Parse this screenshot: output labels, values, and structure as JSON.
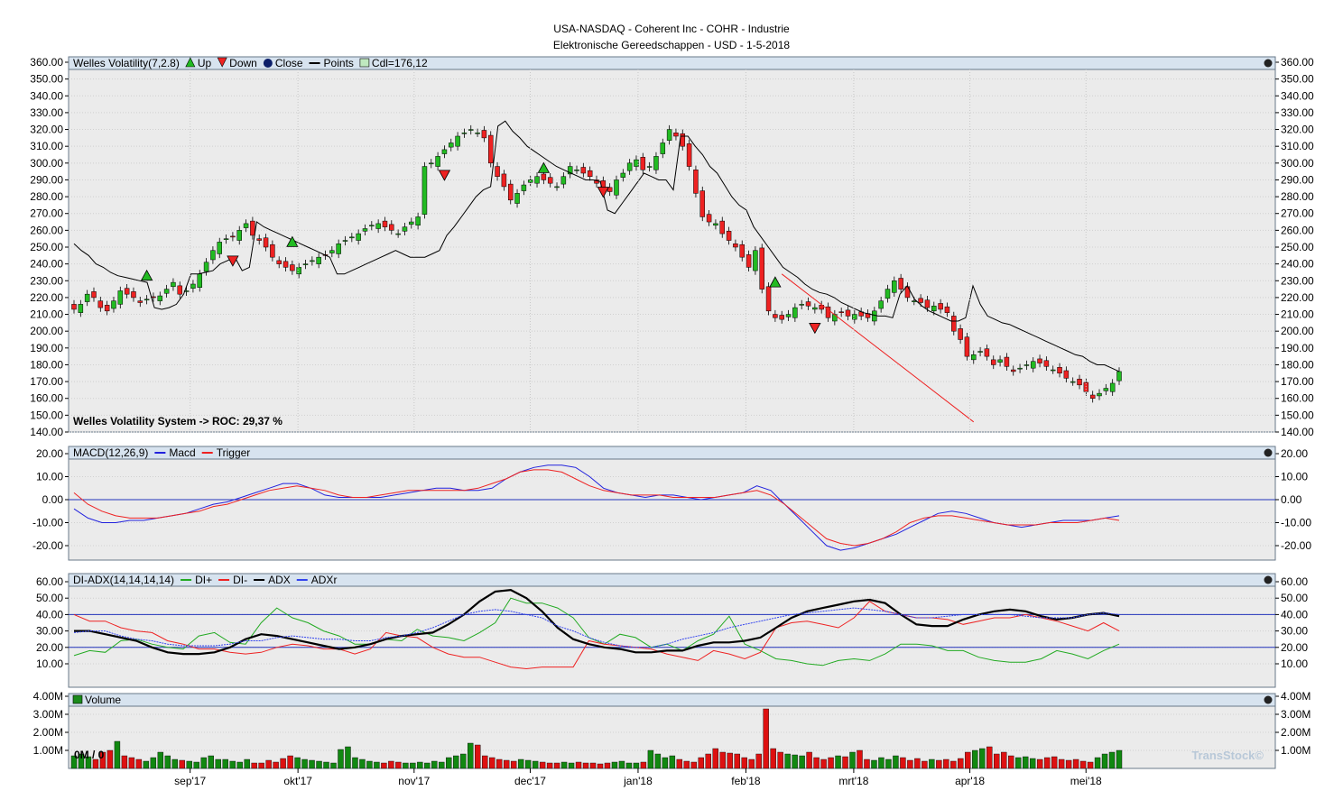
{
  "header": {
    "line1": "USA-NASDAQ - Coherent Inc - COHR - Industrie",
    "line2": "Elektronische Gereedschappen - USD - 1-5-2018"
  },
  "watermark": "TransStock©",
  "colors": {
    "panel_bg": "#ebebeb",
    "header_bg": "#d7e3ef",
    "up": "#22bb22",
    "down": "#ee2222",
    "line": "#000000",
    "macd": "#2222dd",
    "trigger": "#ee2222",
    "diplus": "#22aa22",
    "diminus": "#ee2222",
    "adxr": "#3344ee",
    "vol_up": "#118811",
    "vol_down": "#dd1111"
  },
  "x_axis": {
    "labels": [
      "sep'17",
      "okt'17",
      "nov'17",
      "dec'17",
      "jan'18",
      "feb'18",
      "mrt'18",
      "apr'18",
      "mei'18"
    ],
    "label_bars": [
      14,
      27,
      41,
      55,
      68,
      81,
      94,
      108,
      122
    ]
  },
  "panels": {
    "price": {
      "legend": [
        "Welles Volatility(7,2.8)",
        "Up",
        "Down",
        "Close",
        "Points",
        "Cdl=176,12"
      ],
      "note": "Welles Volatility System -> ROC: 29,37 %",
      "y_ticks": [
        "140.00",
        "150.00",
        "160.00",
        "170.00",
        "180.00",
        "190.00",
        "200.00",
        "210.00",
        "220.00",
        "230.00",
        "240.00",
        "250.00",
        "260.00",
        "270.00",
        "280.00",
        "290.00",
        "300.00",
        "310.00",
        "320.00",
        "330.00",
        "340.00",
        "350.00",
        "360.00"
      ]
    },
    "macd": {
      "legend": [
        "MACD(12,26,9)",
        "Macd",
        "Trigger"
      ],
      "y_ticks": [
        "20.00",
        "10.00",
        "0.00",
        "-10.00",
        "-20.00"
      ]
    },
    "adx": {
      "legend": [
        "DI-ADX(14,14,14,14)",
        "DI+",
        "DI-",
        "ADX",
        "ADXr"
      ],
      "y_ticks": [
        "60.00",
        "50.00",
        "40.00",
        "30.00",
        "20.00",
        "10.00"
      ]
    },
    "volume": {
      "legend": [
        "Volume"
      ],
      "y_ticks": [
        "4.00M",
        "3.00M",
        "2.00M",
        "1.00M"
      ],
      "current_label": "0M / 0"
    }
  },
  "chart_data": [
    {
      "type": "candlestick",
      "title": "Welles Volatility(7,2.8)",
      "ylim": [
        140,
        360
      ],
      "closes": [
        213,
        216,
        222,
        220,
        214,
        212,
        218,
        224,
        222,
        220,
        217,
        219,
        220,
        221,
        225,
        229,
        222,
        224,
        228,
        234,
        241,
        248,
        253,
        255,
        256,
        260,
        264,
        257,
        254,
        250,
        244,
        240,
        238,
        236,
        238,
        240,
        242,
        244,
        245,
        248,
        252,
        254,
        256,
        258,
        261,
        263,
        264,
        262,
        260,
        258,
        262,
        265,
        268,
        298,
        300,
        304,
        308,
        312,
        316,
        318,
        320,
        318,
        315,
        300,
        292,
        286,
        278,
        282,
        287,
        290,
        292,
        290,
        288,
        286,
        292,
        298,
        296,
        294,
        292,
        288,
        284,
        283,
        290,
        294,
        300,
        302,
        296,
        298,
        304,
        312,
        320,
        316,
        310,
        298,
        282,
        268,
        265,
        264,
        258,
        254,
        250,
        244,
        238,
        248,
        225,
        212,
        208,
        207,
        210,
        214,
        216,
        215,
        214,
        213,
        208,
        210,
        211,
        209,
        210,
        209,
        208,
        212,
        218,
        225,
        230,
        225,
        220,
        218,
        217,
        214,
        215,
        213,
        211,
        200,
        195,
        185,
        186,
        188,
        185,
        180,
        183,
        179,
        176,
        178,
        180,
        182,
        181,
        179,
        177,
        175,
        172,
        170,
        168,
        164,
        160,
        163,
        166,
        169,
        176
      ],
      "welles_line": [
        252,
        248,
        245,
        240,
        238,
        235,
        233,
        232,
        231,
        230,
        229,
        214,
        213,
        214,
        216,
        222,
        234,
        234,
        235,
        236,
        240,
        242,
        244,
        236,
        238,
        265,
        262,
        260,
        258,
        256,
        254,
        252,
        250,
        248,
        246,
        244,
        234,
        234,
        236,
        238,
        240,
        242,
        244,
        246,
        248,
        246,
        244,
        244,
        244,
        246,
        248,
        257,
        262,
        268,
        274,
        280,
        284,
        286,
        322,
        325,
        319,
        315,
        310,
        307,
        304,
        301,
        298,
        296,
        294,
        292,
        290,
        290,
        289,
        272,
        270,
        276,
        282,
        288,
        294,
        292,
        290,
        290,
        284,
        316,
        316,
        310,
        305,
        298,
        294,
        287,
        280,
        275,
        272,
        262,
        256,
        250,
        244,
        238,
        235,
        232,
        228,
        225,
        223,
        222,
        220,
        217,
        215,
        213,
        211,
        210,
        209,
        209,
        208,
        222,
        227,
        219,
        215,
        212,
        210,
        208,
        206,
        206,
        208,
        227,
        216,
        209,
        207,
        205,
        204,
        202,
        200,
        198,
        196,
        194,
        192,
        190,
        188,
        186,
        185,
        182,
        180,
        180,
        178,
        176
      ],
      "signals": [
        {
          "type": "Up",
          "bar": 11,
          "price": 233
        },
        {
          "type": "Down",
          "bar": 24,
          "price": 242
        },
        {
          "type": "Up",
          "bar": 33,
          "price": 253
        },
        {
          "type": "Down",
          "bar": 56,
          "price": 293
        },
        {
          "type": "Up",
          "bar": 71,
          "price": 297
        },
        {
          "type": "Down",
          "bar": 80,
          "price": 283
        },
        {
          "type": "Up",
          "bar": 106,
          "price": 229
        },
        {
          "type": "Down",
          "bar": 112,
          "price": 202
        }
      ],
      "trendline": [
        {
          "bar": 107,
          "price": 234
        },
        {
          "bar": 136,
          "price": 146
        }
      ]
    },
    {
      "type": "line",
      "title": "MACD(12,26,9)",
      "ylim": [
        -25,
        22
      ],
      "series": [
        {
          "name": "Macd",
          "values": [
            -4,
            -8,
            -10,
            -10,
            -9,
            -9,
            -8,
            -7,
            -6,
            -4,
            -2,
            -1,
            1,
            3,
            5,
            7,
            7,
            5,
            2,
            1,
            1,
            1,
            1,
            2,
            3,
            4,
            5,
            5,
            4,
            4,
            5,
            9,
            12,
            14,
            15,
            15,
            14,
            10,
            5,
            3,
            2,
            1,
            2,
            2,
            1,
            0,
            1,
            2,
            3,
            6,
            4,
            -2,
            -8,
            -14,
            -20,
            -22,
            -21,
            -19,
            -17,
            -15,
            -12,
            -9,
            -6,
            -5,
            -6,
            -8,
            -10,
            -11,
            -12,
            -11,
            -10,
            -9,
            -9,
            -9,
            -8,
            -7
          ]
        },
        {
          "name": "Trigger",
          "values": [
            3,
            -2,
            -5,
            -7,
            -8,
            -8,
            -8,
            -7,
            -6,
            -5,
            -3,
            -2,
            0,
            2,
            4,
            5,
            6,
            5,
            4,
            2,
            1,
            1,
            2,
            3,
            4,
            4,
            4,
            4,
            4,
            5,
            7,
            9,
            12,
            13,
            13,
            12,
            9,
            6,
            4,
            3,
            2,
            2,
            2,
            1,
            1,
            1,
            1,
            2,
            3,
            4,
            2,
            -2,
            -7,
            -12,
            -17,
            -19,
            -20,
            -19,
            -17,
            -14,
            -10,
            -8,
            -7,
            -7,
            -8,
            -9,
            -10,
            -11,
            -11,
            -11,
            -10,
            -10,
            -10,
            -9,
            -8,
            -9
          ]
        }
      ]
    },
    {
      "type": "line",
      "title": "DI-ADX(14,14,14,14)",
      "ylim": [
        0,
        65
      ],
      "series": [
        {
          "name": "DI+",
          "values": [
            15,
            18,
            17,
            24,
            25,
            22,
            20,
            19,
            27,
            29,
            23,
            22,
            35,
            44,
            38,
            35,
            30,
            27,
            22,
            22,
            25,
            24,
            31,
            27,
            26,
            24,
            29,
            35,
            50,
            47,
            47,
            44,
            38,
            26,
            22,
            28,
            26,
            20,
            22,
            18,
            24,
            28,
            39,
            22,
            18,
            13,
            12,
            10,
            9,
            12,
            13,
            12,
            16,
            22,
            22,
            21,
            18,
            18,
            14,
            12,
            11,
            11,
            13,
            18,
            16,
            13,
            18,
            22
          ]
        },
        {
          "name": "DI-",
          "values": [
            40,
            36,
            36,
            32,
            30,
            29,
            24,
            22,
            19,
            19,
            17,
            16,
            17,
            20,
            22,
            21,
            19,
            19,
            16,
            19,
            29,
            27,
            26,
            20,
            16,
            14,
            14,
            11,
            8,
            7,
            8,
            8,
            8,
            24,
            22,
            21,
            20,
            19,
            16,
            14,
            12,
            18,
            16,
            13,
            17,
            32,
            35,
            36,
            34,
            32,
            38,
            48,
            42,
            40,
            38,
            38,
            37,
            34,
            36,
            38,
            38,
            40,
            38,
            36,
            33,
            30,
            35,
            30
          ]
        },
        {
          "name": "ADX",
          "values": [
            30,
            30,
            28,
            26,
            24,
            20,
            17,
            16,
            16,
            17,
            20,
            25,
            28,
            27,
            25,
            23,
            21,
            19,
            20,
            22,
            25,
            27,
            28,
            29,
            34,
            40,
            48,
            54,
            55,
            50,
            42,
            32,
            25,
            22,
            20,
            19,
            17,
            17,
            18,
            18,
            21,
            23,
            23,
            24,
            26,
            32,
            38,
            42,
            44,
            46,
            48,
            49,
            47,
            40,
            34,
            33,
            33,
            37,
            40,
            42,
            43,
            42,
            39,
            37,
            38,
            40,
            41,
            39
          ]
        },
        {
          "name": "ADXr",
          "values": [
            29,
            30,
            30,
            27,
            25,
            24,
            22,
            21,
            21,
            21,
            22,
            24,
            24,
            26,
            27,
            26,
            25,
            25,
            24,
            24,
            26,
            27,
            29,
            32,
            36,
            40,
            42,
            43,
            42,
            40,
            38,
            33,
            30,
            26,
            23,
            21,
            20,
            20,
            22,
            25,
            27,
            29,
            32,
            34,
            36,
            38,
            40,
            41,
            42,
            43,
            44,
            43,
            42,
            40,
            38,
            38,
            39,
            40,
            40,
            40,
            40,
            39,
            38,
            38,
            38,
            40,
            41,
            40
          ]
        }
      ]
    },
    {
      "type": "bar",
      "title": "Volume",
      "ylim": [
        0,
        4000000
      ],
      "values": [
        700000,
        800000,
        650000,
        500000,
        900000,
        1000000,
        1500000,
        700000,
        600000,
        500000,
        400000,
        600000,
        900000,
        700000,
        500000,
        450000,
        400000,
        350000,
        600000,
        700000,
        500000,
        500000,
        400000,
        350000,
        500000,
        300000,
        300000,
        450000,
        350000,
        550000,
        700000,
        600000,
        500000,
        450000,
        400000,
        350000,
        300000,
        1050000,
        1200000,
        600000,
        500000,
        400000,
        350000,
        300000,
        400000,
        350000,
        300000,
        300000,
        350000,
        300000,
        400000,
        350000,
        600000,
        700000,
        800000,
        1400000,
        1300000,
        700000,
        600000,
        500000,
        450000,
        400000,
        500000,
        450000,
        400000,
        350000,
        300000,
        300000,
        350000,
        300000,
        350000,
        300000,
        300000,
        250000,
        300000,
        350000,
        400000,
        300000,
        300000,
        350000,
        1000000,
        800000,
        600000,
        700000,
        500000,
        400000,
        350000,
        600000,
        800000,
        1100000,
        900000,
        850000,
        800000,
        600000,
        500000,
        800000,
        3300000,
        1100000,
        900000,
        800000,
        750000,
        700000,
        900000,
        600000,
        500000,
        600000,
        700000,
        650000,
        900000,
        1000000,
        500000,
        450000,
        600000,
        500000,
        700000,
        600000,
        450000,
        550000,
        400000,
        500000,
        450000,
        500000,
        400000,
        550000,
        900000,
        1000000,
        1100000,
        1200000,
        800000,
        900000,
        700000,
        600000,
        650000,
        550000,
        500000,
        600000,
        650000,
        500000,
        450000,
        500000,
        400000,
        350000,
        600000,
        800000,
        900000,
        1000000
      ],
      "current_value_label": "0M / 0"
    }
  ]
}
